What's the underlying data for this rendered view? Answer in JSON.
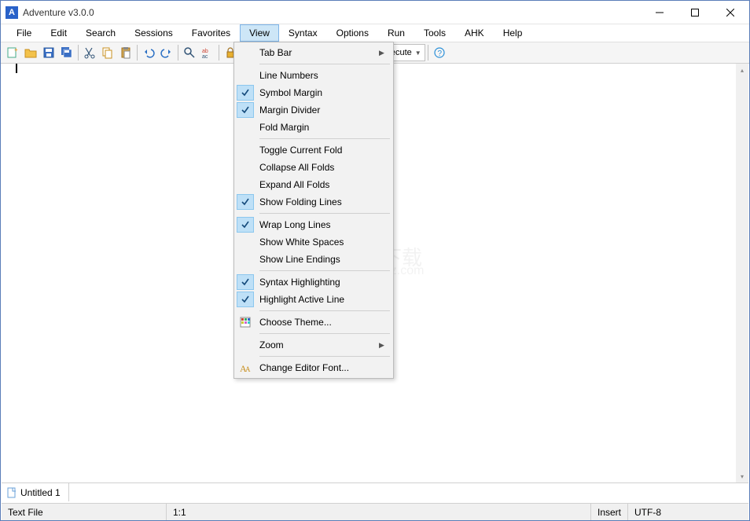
{
  "window": {
    "title": "Adventure v3.0.0",
    "icon_letter": "A"
  },
  "menubar": [
    "File",
    "Edit",
    "Search",
    "Sessions",
    "Favorites",
    "View",
    "Syntax",
    "Options",
    "Run",
    "Tools",
    "AHK",
    "Help"
  ],
  "active_menu": "View",
  "toolbar": {
    "execute_label": "Execute"
  },
  "view_menu": {
    "items": [
      {
        "type": "sub",
        "label": "Tab Bar"
      },
      {
        "type": "sep"
      },
      {
        "type": "item",
        "label": "Line Numbers",
        "checked": false
      },
      {
        "type": "item",
        "label": "Symbol Margin",
        "checked": true
      },
      {
        "type": "item",
        "label": "Margin Divider",
        "checked": true
      },
      {
        "type": "item",
        "label": "Fold Margin",
        "checked": false
      },
      {
        "type": "sep"
      },
      {
        "type": "item",
        "label": "Toggle Current Fold",
        "checked": false
      },
      {
        "type": "item",
        "label": "Collapse All Folds",
        "checked": false
      },
      {
        "type": "item",
        "label": "Expand All Folds",
        "checked": false
      },
      {
        "type": "item",
        "label": "Show Folding Lines",
        "checked": true
      },
      {
        "type": "sep"
      },
      {
        "type": "item",
        "label": "Wrap Long Lines",
        "checked": true
      },
      {
        "type": "item",
        "label": "Show White Spaces",
        "checked": false
      },
      {
        "type": "item",
        "label": "Show Line Endings",
        "checked": false
      },
      {
        "type": "sep"
      },
      {
        "type": "item",
        "label": "Syntax Highlighting",
        "checked": true
      },
      {
        "type": "item",
        "label": "Highlight Active Line",
        "checked": true
      },
      {
        "type": "sep"
      },
      {
        "type": "icon",
        "label": "Choose Theme...",
        "icon": "grid"
      },
      {
        "type": "sep"
      },
      {
        "type": "sub",
        "label": "Zoom"
      },
      {
        "type": "sep"
      },
      {
        "type": "icon",
        "label": "Change Editor Font...",
        "icon": "font"
      }
    ]
  },
  "tab": {
    "name": "Untitled 1"
  },
  "status": {
    "filetype": "Text File",
    "pos": "1:1",
    "insert": "Insert",
    "encoding": "UTF-8"
  },
  "watermark": {
    "main": "安下载",
    "sub": "anxz.com"
  }
}
